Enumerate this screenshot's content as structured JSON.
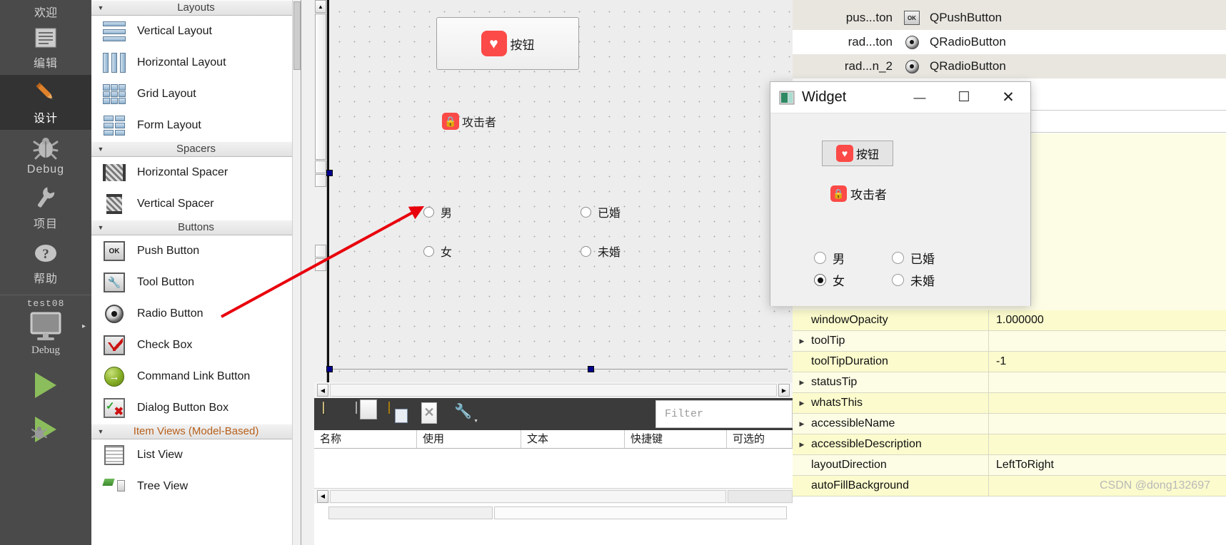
{
  "modebar": {
    "welcome": "欢迎",
    "items": [
      {
        "label": "编辑",
        "icon": "document-lines-icon",
        "selected": false
      },
      {
        "label": "设计",
        "icon": "pencil-icon",
        "selected": true
      },
      {
        "label": "Debug",
        "icon": "bug-icon",
        "selected": false
      },
      {
        "label": "项目",
        "icon": "wrench-icon",
        "selected": false
      },
      {
        "label": "帮助",
        "icon": "question-circle-icon",
        "selected": false
      }
    ],
    "kit": {
      "project": "test08",
      "icon": "monitor-icon",
      "build": "Debug",
      "expand": "▸"
    },
    "run_icon": "run-triangle-icon",
    "debug_icon": "debug-run-icon"
  },
  "widgetbox": {
    "groups": [
      {
        "name": "Layouts",
        "caret": "▼",
        "accent": false,
        "items": [
          {
            "label": "Vertical Layout",
            "icon": "vertical-layout-icon"
          },
          {
            "label": "Horizontal Layout",
            "icon": "horizontal-layout-icon"
          },
          {
            "label": "Grid Layout",
            "icon": "grid-layout-icon"
          },
          {
            "label": "Form Layout",
            "icon": "form-layout-icon"
          }
        ]
      },
      {
        "name": "Spacers",
        "caret": "▼",
        "accent": false,
        "items": [
          {
            "label": "Horizontal Spacer",
            "icon": "horizontal-spacer-icon"
          },
          {
            "label": "Vertical Spacer",
            "icon": "vertical-spacer-icon"
          }
        ]
      },
      {
        "name": "Buttons",
        "caret": "▼",
        "accent": false,
        "items": [
          {
            "label": "Push Button",
            "icon": "push-button-icon"
          },
          {
            "label": "Tool Button",
            "icon": "tool-button-icon"
          },
          {
            "label": "Radio Button",
            "icon": "radio-button-icon"
          },
          {
            "label": "Check Box",
            "icon": "check-box-icon"
          },
          {
            "label": "Command Link Button",
            "icon": "command-link-icon"
          },
          {
            "label": "Dialog Button Box",
            "icon": "dialog-button-box-icon"
          }
        ]
      },
      {
        "name": "Item Views (Model-Based)",
        "caret": "▼",
        "accent": true,
        "items": [
          {
            "label": "List View",
            "icon": "list-view-icon"
          },
          {
            "label": "Tree View",
            "icon": "tree-view-icon"
          }
        ]
      }
    ]
  },
  "canvas": {
    "button": {
      "label": "按钮",
      "icon": "heart-icon"
    },
    "label": {
      "text": "攻击者",
      "icon": "lock-icon"
    },
    "radios": [
      {
        "text": "男",
        "checked": false
      },
      {
        "text": "已婚",
        "checked": false
      },
      {
        "text": "女",
        "checked": false
      },
      {
        "text": "未婚",
        "checked": false
      }
    ]
  },
  "preview": {
    "title": "Widget",
    "icon": "app-window-icon",
    "controls": {
      "minimize": "—",
      "maximize": "☐",
      "close": "✕"
    },
    "button": {
      "label": "按钮",
      "icon": "heart-icon"
    },
    "label": {
      "text": "攻击者",
      "icon": "lock-icon"
    },
    "radios": [
      {
        "text": "男",
        "checked": false
      },
      {
        "text": "已婚",
        "checked": false
      },
      {
        "text": "女",
        "checked": true
      },
      {
        "text": "未婚",
        "checked": false
      }
    ]
  },
  "object_inspector": {
    "rows": [
      {
        "name": "pus...ton",
        "class": "QPushButton",
        "icon": "push-button-icon"
      },
      {
        "name": "rad...ton",
        "class": "QRadioButton",
        "icon": "radio-button-icon"
      },
      {
        "name": "rad...n_2",
        "class": "QRadioButton",
        "icon": "radio-button-icon"
      }
    ]
  },
  "action_editor": {
    "toolbar_icons": [
      "new-action-icon",
      "copy-icon",
      "paste-icon",
      "delete-icon",
      "configure-icon"
    ],
    "filter_placeholder": "Filter",
    "columns": [
      "名称",
      "使用",
      "文本",
      "快捷键",
      "可选的"
    ]
  },
  "property_editor": {
    "rows": [
      {
        "name": "windowOpacity",
        "value": "1.000000",
        "expandable": false
      },
      {
        "name": "toolTip",
        "value": "",
        "expandable": true
      },
      {
        "name": "toolTipDuration",
        "value": "-1",
        "expandable": false
      },
      {
        "name": "statusTip",
        "value": "",
        "expandable": true
      },
      {
        "name": "whatsThis",
        "value": "",
        "expandable": true
      },
      {
        "name": "accessibleName",
        "value": "",
        "expandable": true
      },
      {
        "name": "accessibleDescription",
        "value": "",
        "expandable": true
      },
      {
        "name": "layoutDirection",
        "value": "LeftToRight",
        "expandable": false
      },
      {
        "name": "autoFillBackground",
        "value": "",
        "expandable": false
      }
    ],
    "expand_glyph": "▶"
  },
  "watermark": "CSDN @dong132697",
  "colors": {
    "accent_red": "#fb4a47",
    "selection_blue": "#00008f",
    "property_yellow": "#fbfbcd",
    "modebar_bg": "#4a4a4a",
    "arrow_red": "#e8000c"
  }
}
